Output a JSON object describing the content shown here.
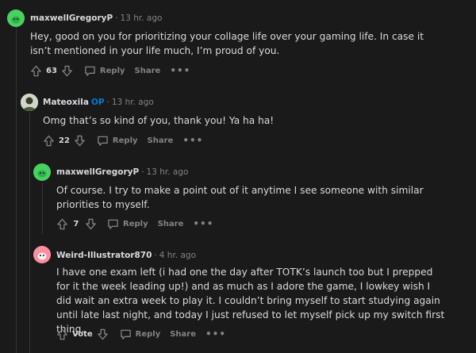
{
  "comments": [
    {
      "author": "maxwellGregoryP",
      "time": "13 hr. ago",
      "body": "Hey, good on you for prioritizing your collage life over your gaming life. In case it isn’t mentioned in your life much, I’m proud of you.",
      "score": "63",
      "avatar_color": "#46d160"
    },
    {
      "author": "Mateoxila",
      "op_badge": "OP",
      "time": "13 hr. ago",
      "body": "Omg that’s so kind of you, thank you! Ya ha ha!",
      "score": "22",
      "avatar_color": "#cfd8c4"
    },
    {
      "author": "maxwellGregoryP",
      "time": "13 hr. ago",
      "body": "Of course. I try to make a point out of it anytime I see someone with similar priorities to myself.",
      "score": "7",
      "avatar_color": "#46d160"
    },
    {
      "author": "Weird-Illustrator870",
      "time": "4 hr. ago",
      "body": "I have one exam left (i had one the day after TOTK’s launch too but I prepped for it the week leading up!) and as much as I adore the game, I lowkey wish I did wait an extra week to play it. I couldn’t bring myself to start studying again until late last night, and today I just refused to let myself pick up my switch first thing.",
      "score": "Vote",
      "avatar_color": "#ff8ea0"
    }
  ],
  "labels": {
    "reply": "Reply",
    "share": "Share",
    "more": "•••",
    "dot": "·"
  },
  "colors": {
    "background": "#1a1a1b",
    "text": "#d7dadc",
    "muted": "#818384",
    "op": "#0079d3",
    "thread_line": "#343536"
  }
}
